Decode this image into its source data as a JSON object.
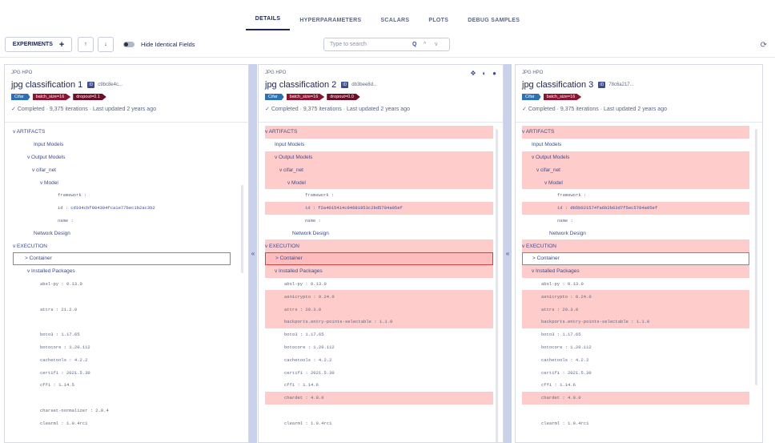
{
  "tabs": [
    "DETAILS",
    "HYPERPARAMETERS",
    "SCALARS",
    "PLOTS",
    "DEBUG SAMPLES"
  ],
  "toolbar": {
    "experiments_label": "EXPERIMENTS",
    "add": "+",
    "up": "↑",
    "down": "↓",
    "hide_identical": "Hide Identical Fields",
    "search_placeholder": "Type to search",
    "search_icon": "Q",
    "nav_up": "^",
    "nav_down": "v"
  },
  "columns": [
    {
      "project": "JPG HPO",
      "title": "jpg classification 1",
      "id_label": "ID",
      "id": "c9bc8e4c...",
      "tags": [
        {
          "text": "Cifar",
          "color": "#2f6fb5"
        },
        {
          "text": "batch_size=16",
          "color": "#8a1530"
        },
        {
          "text": "dropout=0.1",
          "color": "#6a0f27"
        }
      ],
      "status": "Completed · 9,375 iterations · Last updated 2 years ago",
      "rows": [
        {
          "text": "v ARTIFACTS",
          "indent": 0,
          "type": "head",
          "diff": false
        },
        {
          "text": "Input Models",
          "indent": 26,
          "type": "node",
          "diff": false
        },
        {
          "text": "v Output Models",
          "indent": 18,
          "type": "node",
          "diff": false
        },
        {
          "text": "v cifar_net",
          "indent": 24,
          "type": "node",
          "diff": false
        },
        {
          "text": "v Model",
          "indent": 34,
          "type": "node",
          "diff": false
        },
        {
          "text": "framework :",
          "indent": 56,
          "type": "mono",
          "diff": false
        },
        {
          "text": "id :",
          "indent": 56,
          "type": "mono",
          "diff": false,
          "hash": "cd104cbf984394fca1e77bec1b2ac3b2"
        },
        {
          "text": "name :",
          "indent": 56,
          "type": "mono",
          "diff": false
        },
        {
          "text": "Network Design",
          "indent": 26,
          "type": "node",
          "diff": false
        },
        {
          "text": "v EXECUTION",
          "indent": 0,
          "type": "head",
          "diff": false
        },
        {
          "text": "> Container",
          "indent": 14,
          "type": "node",
          "diff": false,
          "hl": true
        },
        {
          "text": "v Installed Packages",
          "indent": 18,
          "type": "node",
          "diff": false
        },
        {
          "text": "absl-py : 0.13.0",
          "indent": 34,
          "type": "mono",
          "diff": false
        },
        {
          "text": "",
          "indent": 34,
          "type": "mono",
          "diff": false
        },
        {
          "text": "attrs : 21.2.0",
          "indent": 34,
          "type": "mono",
          "diff": false
        },
        {
          "text": "",
          "indent": 34,
          "type": "mono",
          "diff": false
        },
        {
          "text": "boto3 : 1.17.65",
          "indent": 34,
          "type": "mono",
          "diff": false
        },
        {
          "text": "botocore : 1.20.112",
          "indent": 34,
          "type": "mono",
          "diff": false
        },
        {
          "text": "cachetools : 4.2.2",
          "indent": 34,
          "type": "mono",
          "diff": false
        },
        {
          "text": "certifi : 2021.5.30",
          "indent": 34,
          "type": "mono",
          "diff": false
        },
        {
          "text": "cffi : 1.14.5",
          "indent": 34,
          "type": "mono",
          "diff": false
        },
        {
          "text": "",
          "indent": 34,
          "type": "mono",
          "diff": false
        },
        {
          "text": "charset-normalizer : 2.0.4",
          "indent": 34,
          "type": "mono",
          "diff": false
        },
        {
          "text": "clearml : 1.0.4rc1",
          "indent": 34,
          "type": "mono",
          "diff": false
        }
      ]
    },
    {
      "project": "JPG HPO",
      "title": "jpg classification 2",
      "id_label": "ID",
      "id": "db3bee8d...",
      "tags": [
        {
          "text": "Cifar",
          "color": "#2f6fb5"
        },
        {
          "text": "batch_size=16",
          "color": "#8a1530"
        },
        {
          "text": "dropout=0.0",
          "color": "#6a0f27"
        }
      ],
      "status": "Completed · 9,375 iterations · Last updated 2 years ago",
      "rows": [
        {
          "text": "v ARTIFACTS",
          "indent": 0,
          "type": "head",
          "diff": true
        },
        {
          "text": "Input Models",
          "indent": 12,
          "type": "node",
          "diff": false
        },
        {
          "text": "v Output Models",
          "indent": 12,
          "type": "node",
          "diff": true
        },
        {
          "text": "v cifar_net",
          "indent": 18,
          "type": "node",
          "diff": true
        },
        {
          "text": "v Model",
          "indent": 28,
          "type": "node",
          "diff": true
        },
        {
          "text": "framework :",
          "indent": 50,
          "type": "mono",
          "diff": false
        },
        {
          "text": "id :",
          "indent": 50,
          "type": "mono",
          "diff": true,
          "hash": "f2a4015414c94681953c2bd5784a05ef"
        },
        {
          "text": "name :",
          "indent": 50,
          "type": "mono",
          "diff": false
        },
        {
          "text": "Network Design",
          "indent": 34,
          "type": "node",
          "diff": false
        },
        {
          "text": "v EXECUTION",
          "indent": 0,
          "type": "head",
          "diff": true
        },
        {
          "text": "> Container",
          "indent": 12,
          "type": "node",
          "diff": true,
          "hl": true
        },
        {
          "text": "v Installed Packages",
          "indent": 12,
          "type": "node",
          "diff": true
        },
        {
          "text": "absl-py : 0.13.0",
          "indent": 24,
          "type": "mono",
          "diff": false
        },
        {
          "text": "asn1crypto : 0.24.0",
          "indent": 24,
          "type": "mono",
          "diff": true
        },
        {
          "text": "attrs : 20.3.0",
          "indent": 24,
          "type": "mono",
          "diff": true
        },
        {
          "text": "backports.entry-points-selectable : 1.1.0",
          "indent": 24,
          "type": "mono",
          "diff": true
        },
        {
          "text": "boto3 : 1.17.65",
          "indent": 24,
          "type": "mono",
          "diff": false
        },
        {
          "text": "botocore : 1.20.112",
          "indent": 24,
          "type": "mono",
          "diff": false
        },
        {
          "text": "cachetools : 4.2.2",
          "indent": 24,
          "type": "mono",
          "diff": false
        },
        {
          "text": "certifi : 2021.5.30",
          "indent": 24,
          "type": "mono",
          "diff": false
        },
        {
          "text": "cffi : 1.14.6",
          "indent": 24,
          "type": "mono",
          "diff": false
        },
        {
          "text": "chardet : 4.0.0",
          "indent": 24,
          "type": "mono",
          "diff": true
        },
        {
          "text": "",
          "indent": 24,
          "type": "mono",
          "diff": false
        },
        {
          "text": "clearml : 1.0.4rc1",
          "indent": 24,
          "type": "mono",
          "diff": false
        }
      ]
    },
    {
      "project": "JPG HPO",
      "title": "jpg classification 3",
      "id_label": "ID",
      "id": "78c6a217...",
      "tags": [
        {
          "text": "Cifar",
          "color": "#2f6fb5"
        },
        {
          "text": "batch_size=16",
          "color": "#8a1530"
        }
      ],
      "status": "Completed · 9,375 iterations · Last updated 2 years ago",
      "rows": [
        {
          "text": "v ARTIFACTS",
          "indent": 0,
          "type": "head",
          "diff": true
        },
        {
          "text": "Input Models",
          "indent": 12,
          "type": "node",
          "diff": false
        },
        {
          "text": "v Output Models",
          "indent": 12,
          "type": "node",
          "diff": true
        },
        {
          "text": "v cifar_net",
          "indent": 18,
          "type": "node",
          "diff": true
        },
        {
          "text": "v Model",
          "indent": 28,
          "type": "node",
          "diff": true
        },
        {
          "text": "framework :",
          "indent": 44,
          "type": "mono",
          "diff": false
        },
        {
          "text": "id :",
          "indent": 44,
          "type": "mono",
          "diff": true,
          "hash": "db5b021574fa6b2b63d7f5ec5784a05ef"
        },
        {
          "text": "name :",
          "indent": 44,
          "type": "mono",
          "diff": false
        },
        {
          "text": "Network Design",
          "indent": 34,
          "type": "node",
          "diff": false
        },
        {
          "text": "v EXECUTION",
          "indent": 0,
          "type": "head",
          "diff": true
        },
        {
          "text": "> Container",
          "indent": 12,
          "type": "node",
          "diff": false,
          "hl": true
        },
        {
          "text": "v Installed Packages",
          "indent": 12,
          "type": "node",
          "diff": true
        },
        {
          "text": "absl-py : 0.13.0",
          "indent": 24,
          "type": "mono",
          "diff": false
        },
        {
          "text": "asn1crypto : 0.24.0",
          "indent": 24,
          "type": "mono",
          "diff": true
        },
        {
          "text": "attrs : 20.3.0",
          "indent": 24,
          "type": "mono",
          "diff": true
        },
        {
          "text": "backports.entry-points-selectable : 1.1.0",
          "indent": 24,
          "type": "mono",
          "diff": true
        },
        {
          "text": "boto3 : 1.17.65",
          "indent": 24,
          "type": "mono",
          "diff": false
        },
        {
          "text": "botocore : 1.20.112",
          "indent": 24,
          "type": "mono",
          "diff": false
        },
        {
          "text": "cachetools : 4.2.2",
          "indent": 24,
          "type": "mono",
          "diff": false
        },
        {
          "text": "certifi : 2021.5.30",
          "indent": 24,
          "type": "mono",
          "diff": false
        },
        {
          "text": "cffi : 1.14.6",
          "indent": 24,
          "type": "mono",
          "diff": false
        },
        {
          "text": "chardet : 4.0.0",
          "indent": 24,
          "type": "mono",
          "diff": true
        },
        {
          "text": "",
          "indent": 24,
          "type": "mono",
          "diff": false
        },
        {
          "text": "clearml : 1.0.4rc1",
          "indent": 24,
          "type": "mono",
          "diff": false
        }
      ]
    }
  ],
  "collapse_icon": "«",
  "header_actions": [
    "✥",
    "◐",
    "●"
  ]
}
